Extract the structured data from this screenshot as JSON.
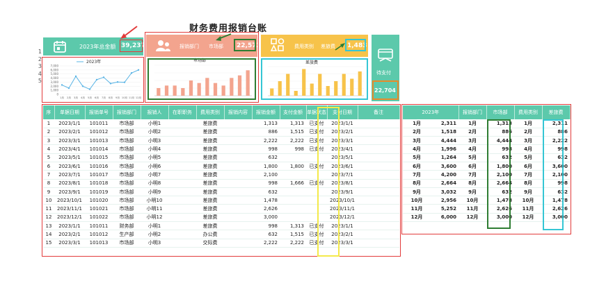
{
  "title": "财务费用报销台账",
  "row_numbers": [
    "1",
    "2",
    "3",
    "4",
    "5"
  ],
  "cards": {
    "total_label": "2023年总金额",
    "total_value": "39,237",
    "dept_label": "报销部门",
    "dept_name": "市场部",
    "dept_value": "22,573",
    "cat_label": "费用类别",
    "cat_name": "差旅费",
    "cat_value": "1,483",
    "pending_label": "待支付",
    "pending_value": "22,704"
  },
  "colors": {
    "teal": "#5cc9ab",
    "salmon": "#f3a48e",
    "amber": "#f7c34a",
    "line": "#5ab4e5"
  },
  "icons": {
    "calendar": "calendar-icon",
    "people": "people-icon",
    "grid": "grid-icon",
    "payment": "payment-icon"
  },
  "chart_data": [
    {
      "type": "line",
      "title": "2023年",
      "legend": "2023年",
      "categories": [
        "1月",
        "2月",
        "3月",
        "4月",
        "5月",
        "6月",
        "7月",
        "8月",
        "9月",
        "10月",
        "11月",
        "12月"
      ],
      "values": [
        2311,
        1518,
        4444,
        1996,
        1264,
        3600,
        4200,
        2664,
        3032,
        2956,
        5252,
        6000
      ],
      "ylim": [
        0,
        7000
      ],
      "yticks": [
        "0",
        "1,000",
        "2,000",
        "3,000",
        "4,000",
        "5,000",
        "6,000",
        "7,000"
      ]
    },
    {
      "type": "bar",
      "title": "市场部",
      "values": [
        3,
        4,
        4,
        3,
        6,
        5,
        7,
        5,
        4,
        7,
        8,
        10
      ],
      "ylim": [
        0,
        12
      ],
      "color": "#f3a48e"
    },
    {
      "type": "bar",
      "title": "差旅费",
      "values": [
        3,
        6,
        9,
        2,
        11,
        5,
        9,
        4,
        6,
        9,
        7,
        10
      ],
      "ylim": [
        0,
        12
      ],
      "color": "#f7c34a"
    }
  ],
  "headers": [
    "序",
    "单据日期",
    "报销单号",
    "报销部门",
    "报销人",
    "在职职务",
    "费用类别",
    "报销内容",
    "报销金额",
    "支付金额",
    "单据状态",
    "支付日期",
    "备注"
  ],
  "rows": [
    [
      "1",
      "2023/1/1",
      "101011",
      "市场部",
      "小明1",
      "",
      "差旅费",
      "",
      "1,313",
      "1,313",
      "已支付",
      "2023/1/1",
      ""
    ],
    [
      "2",
      "2023/2/1",
      "101012",
      "市场部",
      "小明2",
      "",
      "差旅费",
      "",
      "886",
      "1,515",
      "已支付",
      "2023/2/1",
      ""
    ],
    [
      "3",
      "2023/3/1",
      "101013",
      "市场部",
      "小明3",
      "",
      "差旅费",
      "",
      "2,222",
      "2,222",
      "已支付",
      "2023/3/1",
      ""
    ],
    [
      "4",
      "2023/4/1",
      "101014",
      "市场部",
      "小明4",
      "",
      "差旅费",
      "",
      "998",
      "998",
      "已支付",
      "2023/4/1",
      ""
    ],
    [
      "5",
      "2023/5/1",
      "101015",
      "市场部",
      "小明5",
      "",
      "差旅费",
      "",
      "632",
      "",
      "",
      "2023/5/1",
      ""
    ],
    [
      "6",
      "2023/6/1",
      "101016",
      "市场部",
      "小明6",
      "",
      "差旅费",
      "",
      "1,800",
      "1,800",
      "已支付",
      "2023/6/1",
      ""
    ],
    [
      "7",
      "2023/7/1",
      "101017",
      "市场部",
      "小明7",
      "",
      "差旅费",
      "",
      "2,100",
      "",
      "",
      "2023/7/1",
      ""
    ],
    [
      "8",
      "2023/8/1",
      "101018",
      "市场部",
      "小明8",
      "",
      "差旅费",
      "",
      "998",
      "1,666",
      "已支付",
      "2023/8/1",
      ""
    ],
    [
      "9",
      "2023/9/1",
      "101019",
      "市场部",
      "小明9",
      "",
      "差旅费",
      "",
      "632",
      "",
      "",
      "2023/9/1",
      ""
    ],
    [
      "10",
      "2023/10/1",
      "101020",
      "市场部",
      "小明10",
      "",
      "差旅费",
      "",
      "1,478",
      "",
      "",
      "2023/10/1",
      ""
    ],
    [
      "11",
      "2023/11/1",
      "101021",
      "市场部",
      "小明11",
      "",
      "差旅费",
      "",
      "2,626",
      "",
      "",
      "2023/11/1",
      ""
    ],
    [
      "12",
      "2023/12/1",
      "101022",
      "市场部",
      "小明12",
      "",
      "差旅费",
      "",
      "3,000",
      "",
      "",
      "2023/12/1",
      ""
    ],
    [
      "13",
      "2023/1/1",
      "101011",
      "财务部",
      "小明1",
      "",
      "差旅费",
      "",
      "998",
      "1,313",
      "已支付",
      "2023/1/1",
      ""
    ],
    [
      "14",
      "2023/2/1",
      "101012",
      "生产部",
      "小明2",
      "",
      "办公费",
      "",
      "632",
      "1,515",
      "已支付",
      "2023/2/1",
      ""
    ],
    [
      "15",
      "2023/3/1",
      "101013",
      "市场部",
      "小明3",
      "",
      "交际费",
      "",
      "2,222",
      "2,222",
      "已支付",
      "2023/3/1",
      ""
    ]
  ],
  "summary_headers": [
    "2023年",
    "",
    "报销部门",
    "市场部",
    "费用类别",
    "差旅费"
  ],
  "summary_rows": [
    [
      "1月",
      "2,311",
      "1月",
      "1,313",
      "1月",
      "2,311"
    ],
    [
      "2月",
      "1,518",
      "2月",
      "886",
      "2月",
      "886"
    ],
    [
      "3月",
      "4,444",
      "3月",
      "4,444",
      "3月",
      "2,222"
    ],
    [
      "4月",
      "1,996",
      "4月",
      "998",
      "4月",
      "998"
    ],
    [
      "5月",
      "1,264",
      "5月",
      "632",
      "5月",
      "632"
    ],
    [
      "6月",
      "3,600",
      "6月",
      "1,800",
      "6月",
      "3,600"
    ],
    [
      "7月",
      "4,200",
      "7月",
      "2,100",
      "7月",
      "2,100"
    ],
    [
      "8月",
      "2,664",
      "8月",
      "2,664",
      "8月",
      "998"
    ],
    [
      "9月",
      "3,032",
      "9月",
      "632",
      "9月",
      "632"
    ],
    [
      "10月",
      "2,956",
      "10月",
      "1,478",
      "10月",
      "1,478"
    ],
    [
      "11月",
      "5,252",
      "11月",
      "2,626",
      "11月",
      "2,626"
    ],
    [
      "12月",
      "6,000",
      "12月",
      "3,000",
      "12月",
      "3,000"
    ]
  ]
}
